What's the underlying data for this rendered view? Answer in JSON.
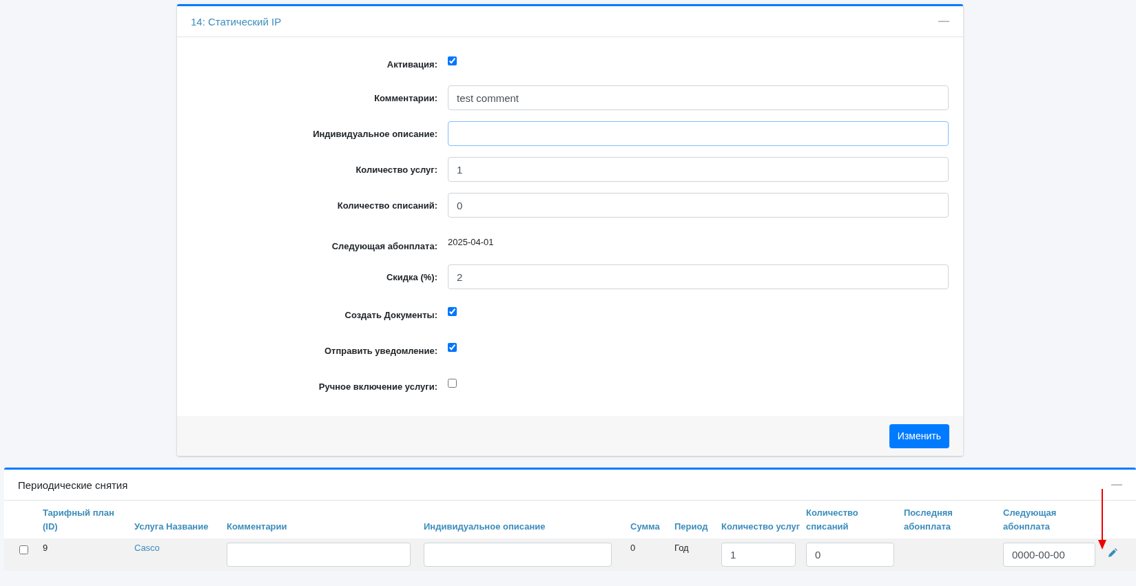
{
  "service_card": {
    "title": "14: Статический IP",
    "collapse_icon": "—",
    "fields": [
      {
        "kind": "checkbox",
        "label": "Активация:",
        "checked": true
      },
      {
        "kind": "input",
        "label": "Комментарии:",
        "value": "test comment",
        "focused": false
      },
      {
        "kind": "input",
        "label": "Индивидуальное описание:",
        "focused": true
      },
      {
        "kind": "input",
        "label": "Количество услуг:",
        "value": "1",
        "focused": false
      },
      {
        "kind": "input",
        "label": "Количество списаний:",
        "value": "0",
        "focused": false
      },
      {
        "kind": "text",
        "label": "Следующая абонплата:",
        "value": "2025-04-01"
      },
      {
        "kind": "input",
        "label": "Скидка (%):",
        "value": "2",
        "focused": false
      },
      {
        "kind": "checkbox",
        "label": "Создать Документы:",
        "checked": true
      },
      {
        "kind": "checkbox",
        "label": "Отправить уведомление:",
        "checked": true
      },
      {
        "kind": "checkbox",
        "label": "Ручное включение услуги:",
        "checked": false
      }
    ],
    "submit_button": "Изменить"
  },
  "periodic_panel": {
    "title": "Периодические снятия",
    "collapse_icon": "—",
    "table": {
      "columns": [
        null,
        "Тарифный план (ID)",
        "Услуга Название",
        "Комментарии",
        "Индивидуальное описание",
        "Сумма",
        "Период",
        "Количество услуг",
        "Количество списаний",
        "Последняя абонплата",
        "Следующая абонплата",
        null
      ],
      "rows": [
        {
          "checked": false,
          "plan_id": "9",
          "service": "Casco",
          "sum": "0",
          "period": "Год",
          "quantity": "1",
          "charges": "0",
          "next_payment": "0000-00-00"
        }
      ]
    }
  }
}
